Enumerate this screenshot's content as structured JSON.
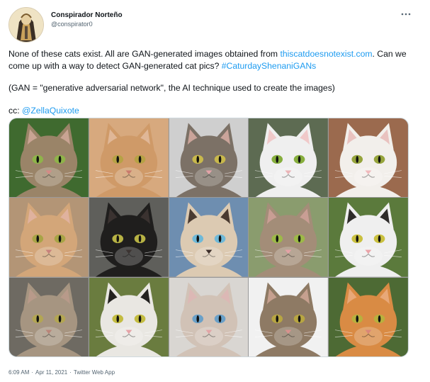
{
  "author": {
    "name": "Conspirador Norteño",
    "handle": "@conspirator0"
  },
  "tweet": {
    "para1_before_link": "None of these cats exist. All are GAN-generated images obtained from ",
    "para1_link": "thiscatdoesnotexist.com",
    "para1_after_link": ". Can we come up with a way to detect GAN-generated cat pics? ",
    "para1_hashtag": "#CaturdayShenaniGANs",
    "para2": "(GAN = \"generative adversarial network\", the AI technique used to create the images)",
    "para3_prefix": "cc: ",
    "para3_mention": "@ZellaQuixote"
  },
  "image": {
    "cats": [
      {
        "bg": "#3f6a2f",
        "fur": "#9a8468",
        "ear": "#c9a493",
        "eye": "#8fb34a",
        "nose": "#d58a86"
      },
      {
        "bg": "#d7a97e",
        "fur": "#cf9a68",
        "ear": "#e0b797",
        "eye": "#b6a245",
        "nose": "#c97a6c"
      },
      {
        "bg": "#cfcfcf",
        "fur": "#7c7166",
        "ear": "#caa49a",
        "eye": "#c8b84c",
        "nose": "#e3a3a8"
      },
      {
        "bg": "#5d6b52",
        "fur": "#efefef",
        "ear": "#f0c9c9",
        "eye": "#86ae3d",
        "nose": "#eab4b7"
      },
      {
        "bg": "#9b6a4e",
        "fur": "#f2efeb",
        "ear": "#e9c2bf",
        "eye": "#96a43c",
        "nose": "#f0b9bc"
      },
      {
        "bg": "#b39576",
        "fur": "#d3a679",
        "ear": "#e0b29e",
        "eye": "#a8a446",
        "nose": "#c7817b"
      },
      {
        "bg": "#5f5f5b",
        "fur": "#1f1e1d",
        "ear": "#3a3230",
        "eye": "#b7b244",
        "nose": "#3b3331"
      },
      {
        "bg": "#6e8eb0",
        "fur": "#dccab2",
        "ear": "#4a3a30",
        "eye": "#6fb9d8",
        "nose": "#3a2c28"
      },
      {
        "bg": "#8a9c6e",
        "fur": "#a38d78",
        "ear": "#c99e94",
        "eye": "#9db948",
        "nose": "#e4a2a6"
      },
      {
        "bg": "#5b7a3c",
        "fur": "#efefef",
        "ear": "#2e2b2a",
        "eye": "#c9c03f",
        "nose": "#eaa3a8"
      },
      {
        "bg": "#6e6a62",
        "fur": "#a69581",
        "ear": "#b89a8a",
        "eye": "#b3a653",
        "nose": "#b98478"
      },
      {
        "bg": "#6a7c3f",
        "fur": "#e9e7e2",
        "ear": "#23211f",
        "eye": "#c3bc41",
        "nose": "#e5a2a6"
      },
      {
        "bg": "#d9d6d2",
        "fur": "#d1c2b6",
        "ear": "#dcb8b5",
        "eye": "#6aa0c8",
        "nose": "#e2a4a6"
      },
      {
        "bg": "#f1f1f1",
        "fur": "#8e7a64",
        "ear": "#c6a08f",
        "eye": "#b7a542",
        "nose": "#d8918e"
      },
      {
        "bg": "#4d6a34",
        "fur": "#d98b44",
        "ear": "#e8a878",
        "eye": "#b8b03e",
        "nose": "#d98578"
      }
    ]
  },
  "footer": {
    "time": "6:09 AM",
    "date": "Apr 11, 2021",
    "source": "Twitter Web App"
  },
  "colors": {
    "link": "#1d9bf0",
    "secondary_text": "#536471",
    "border": "#cfd9de"
  },
  "icons": {
    "more": "more-horizontal-icon"
  }
}
